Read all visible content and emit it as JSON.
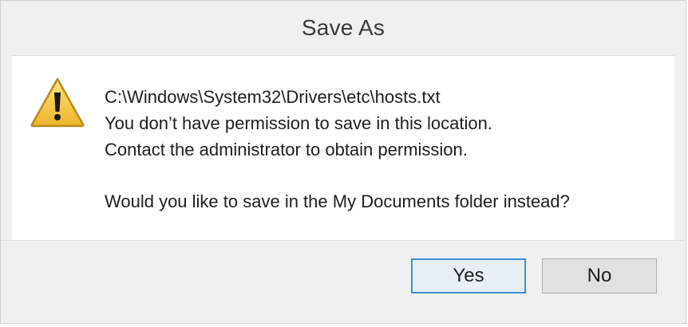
{
  "window": {
    "title": "Save As"
  },
  "icon": "warning-triangle-icon",
  "message": {
    "path": "C:\\Windows\\System32\\Drivers\\etc\\hosts.txt",
    "line1": "You don’t have permission to save in this location.",
    "line2": "Contact the administrator to obtain permission.",
    "question": "Would you like to save in the My Documents folder instead?"
  },
  "buttons": {
    "yes": "Yes",
    "no": "No"
  },
  "colors": {
    "default_button_border": "#3c8fdc",
    "warning_fill": "#f7c844",
    "warning_outline": "#b68a1e"
  }
}
